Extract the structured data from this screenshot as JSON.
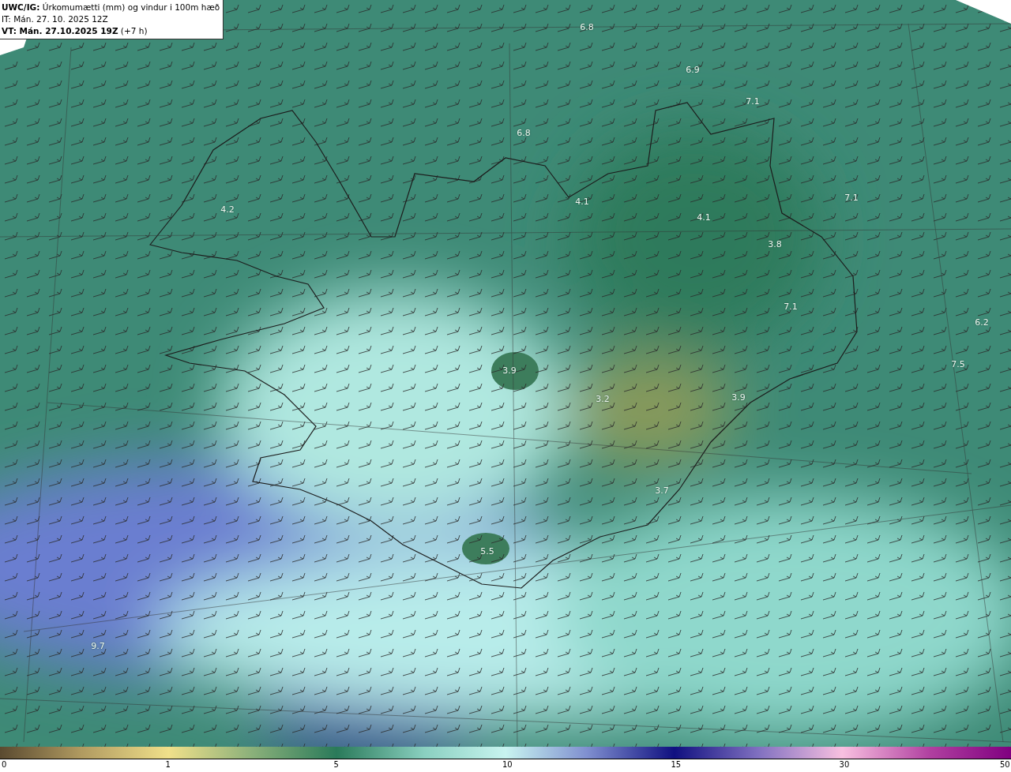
{
  "header": {
    "title": "**UWC/IG:** Úrkomumætti (mm) og vindur i 100m hæð",
    "init_time": "IT: Mán. 27. 10. 2025 12Z",
    "valid_time": "**VT: Mán. 27.10.2025 19Z** (+7 h)"
  },
  "map": {
    "value_labels": [
      {
        "text": "6.8"
      },
      {
        "text": "6.9"
      },
      {
        "text": "7.1"
      },
      {
        "text": "6.8"
      },
      {
        "text": "4.2"
      },
      {
        "text": "4.1"
      },
      {
        "text": "4.1"
      },
      {
        "text": "7.1"
      },
      {
        "text": "3.8"
      },
      {
        "text": "7.1"
      },
      {
        "text": "6.2"
      },
      {
        "text": "7.5"
      },
      {
        "text": "3.9"
      },
      {
        "text": "3.2"
      },
      {
        "text": "3.9"
      },
      {
        "text": "3.7"
      },
      {
        "text": "5.5"
      },
      {
        "text": "9.7"
      }
    ]
  },
  "colorbar": {
    "ticks": [
      "0",
      "1",
      "5",
      "10",
      "15",
      "30",
      "50"
    ]
  }
}
